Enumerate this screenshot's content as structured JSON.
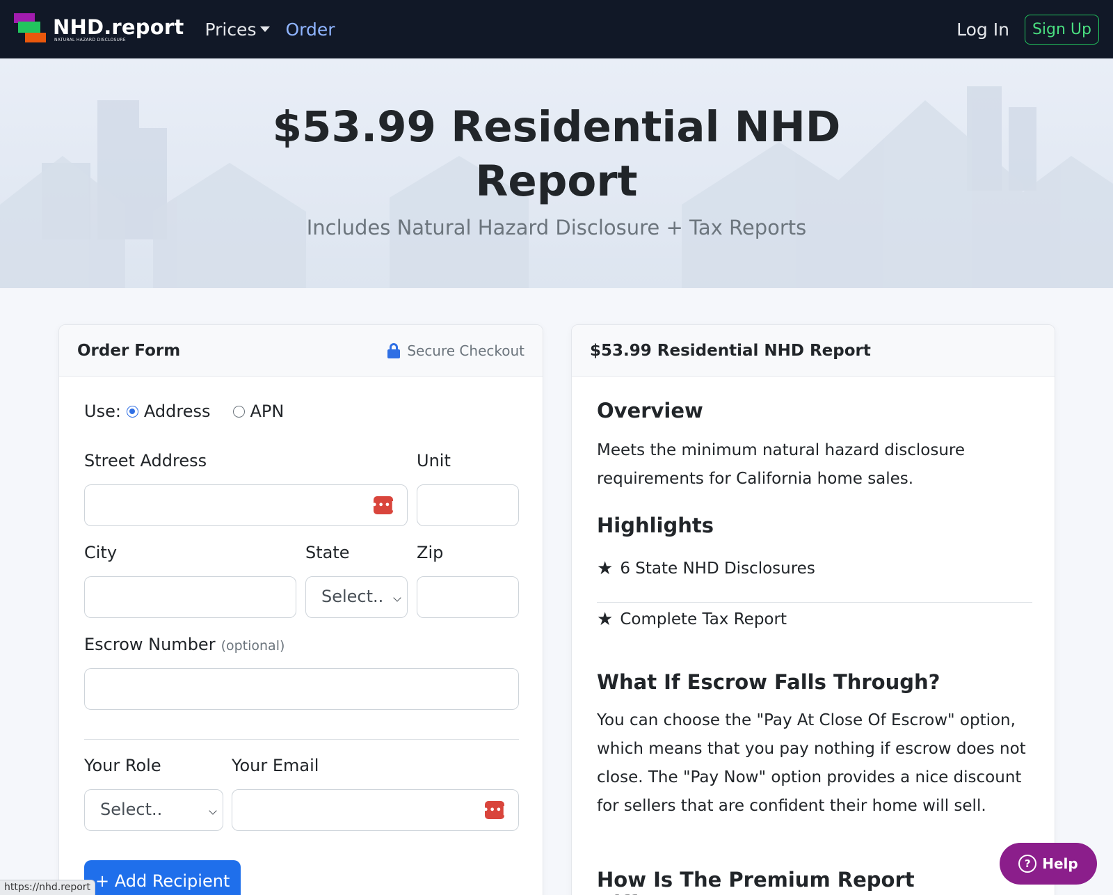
{
  "nav": {
    "brand_name": "NHD.report",
    "brand_sub": "NATURAL HAZARD DISCLOSURE",
    "prices_label": "Prices",
    "order_label": "Order",
    "login_label": "Log In",
    "signup_label": "Sign Up"
  },
  "hero": {
    "title": "$53.99 Residential NHD Report",
    "subtitle": "Includes Natural Hazard Disclosure + Tax Reports"
  },
  "order_form": {
    "title": "Order Form",
    "secure_label": "Secure Checkout",
    "use_label": "Use:",
    "radio_address": "Address",
    "radio_apn": "APN",
    "street_label": "Street Address",
    "unit_label": "Unit",
    "city_label": "City",
    "state_label": "State",
    "state_value": "Select..",
    "zip_label": "Zip",
    "escrow_label": "Escrow Number",
    "escrow_optional": "(optional)",
    "role_label": "Your Role",
    "role_value": "Select..",
    "email_label": "Your Email",
    "add_recipient": "+ Add Recipient",
    "password_icon_text": "•••|"
  },
  "details": {
    "title": "$53.99 Residential NHD Report",
    "overview_heading": "Overview",
    "overview_text": "Meets the minimum natural hazard disclosure requirements for California home sales.",
    "highlights_heading": "Highlights",
    "highlights": [
      {
        "star": "★",
        "text": "6 State NHD Disclosures"
      },
      {
        "star": "★",
        "text": "Complete Tax Report"
      }
    ],
    "escrow_heading": "What If Escrow Falls Through?",
    "escrow_text": "You can choose the \"Pay At Close Of Escrow\" option, which means that you pay nothing if escrow does not close. The \"Pay Now\" option provides a nice discount for sellers that are confident their home will sell.",
    "premium_heading": "How Is The Premium Report Different?"
  },
  "help": {
    "label": "Help",
    "icon": "?"
  },
  "status_bar": {
    "url": "https://nhd.report"
  },
  "colors": {
    "navbar_bg": "#111827",
    "accent": "#1f6feb",
    "signup_green": "#22c55e",
    "help_purple": "#8b1e8b",
    "password_icon": "#d9453c"
  }
}
